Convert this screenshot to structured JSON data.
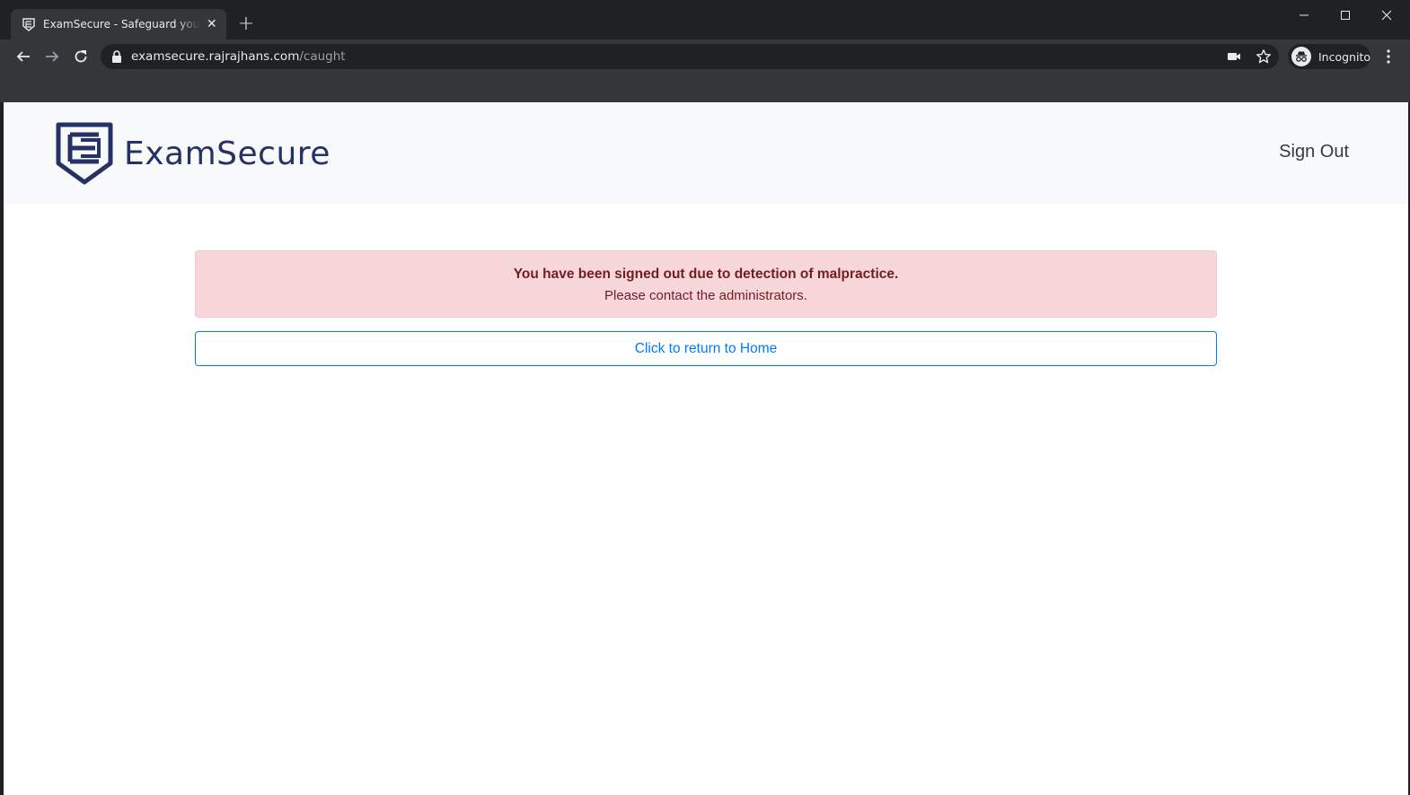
{
  "browser": {
    "tab_title": "ExamSecure - Safeguard your Exams",
    "url_host": "examsecure.rajrajhans.com",
    "url_path": "/caught",
    "profile_label": "Incognito"
  },
  "navbar": {
    "brand": "ExamSecure",
    "sign_out": "Sign Out"
  },
  "alert": {
    "heading": "You have been signed out due to detection of malpractice.",
    "message": "Please contact the administrators."
  },
  "home_button": "Click to return to Home",
  "colors": {
    "brand": "#263164",
    "alert_bg": "#f8d7da",
    "alert_text": "#721c24",
    "button": "#007bff"
  }
}
